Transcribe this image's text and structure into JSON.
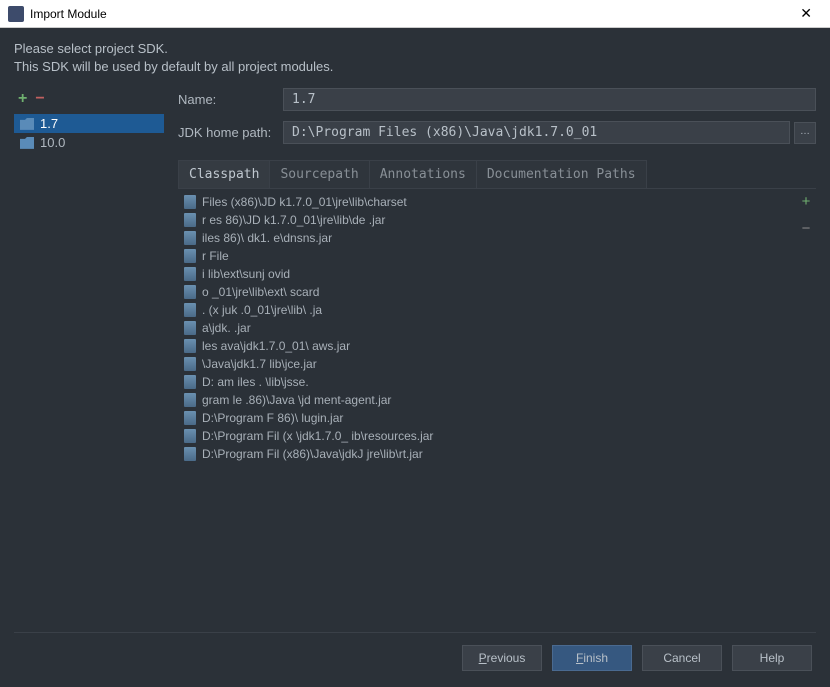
{
  "window": {
    "title": "Import Module"
  },
  "header": {
    "line1": "Please select project SDK.",
    "line2": "This SDK will be used by default by all project modules."
  },
  "sdk_list": {
    "items": [
      {
        "label": "1.7",
        "selected": true
      },
      {
        "label": "10.0",
        "selected": false
      }
    ]
  },
  "form": {
    "name_label": "Name:",
    "name_value": "1.7",
    "path_label": "JDK home path:",
    "path_value": "D:\\Program Files (x86)\\Java\\jdk1.7.0_01"
  },
  "tabs": {
    "items": [
      {
        "label": "Classpath",
        "active": true
      },
      {
        "label": "Sourcepath",
        "active": false
      },
      {
        "label": "Annotations",
        "active": false
      },
      {
        "label": "Documentation Paths",
        "active": false
      }
    ]
  },
  "classpath": {
    "items": [
      "           Files (x86)\\JD    k1.7.0_01\\jre\\lib\\charset",
      "    r      es   86)\\JD    k1.7.0_01\\jre\\lib\\de    .jar",
      "         iles   86)\\    dk1.                e\\dnsns.jar",
      "    r    File",
      "         i                        lib\\ext\\sunj   ovid",
      "                   o         _01\\jre\\lib\\ext\\   scard",
      "               . (x      juk    .0_01\\jre\\lib\\       .ja",
      "                      a\\jdk.                      .jar",
      "          les      ava\\jdk1.7.0_01\\            aws.jar",
      "                   \\Java\\jdk1.7         lib\\jce.jar",
      "D:    am   iles               .      \\lib\\jsse.",
      "    gram   le   .86)\\Java          \\jd         ment-agent.jar",
      "D:\\Program F    86)\\                       lugin.jar",
      "D:\\Program Fil   (x      \\jdk1.7.0_        ib\\resources.jar",
      "D:\\Program Fil   (x86)\\Java\\jdkJ      jre\\lib\\rt.jar"
    ]
  },
  "buttons": {
    "previous": "Previous",
    "finish": "Finish",
    "cancel": "Cancel",
    "help": "Help"
  }
}
